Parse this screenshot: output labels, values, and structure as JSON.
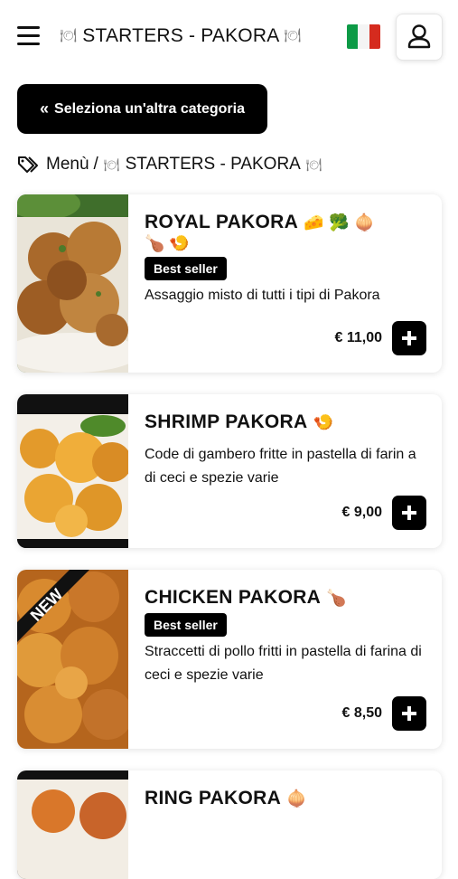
{
  "header": {
    "title": "STARTERS - PAKORA",
    "plate_glyph": "🍽",
    "flag_colors": [
      "#0d9a46",
      "#ffffff",
      "#d52b1e"
    ]
  },
  "category_button": {
    "chevron": "«",
    "label": "Seleziona un'altra categoria"
  },
  "breadcrumb": {
    "menu": "Menù",
    "separator": "/",
    "current": "STARTERS - PAKORA"
  },
  "products": [
    {
      "name": "ROYAL PAKORA",
      "emojis": "🧀 🥦 🧅",
      "emojis2": "🍗 🍤",
      "badge": "Best seller",
      "description": "Assaggio misto di tutti i tipi di Pakora",
      "price": "€ 11,00"
    },
    {
      "name": "SHRIMP PAKORA",
      "emojis": "🍤",
      "description": "Code di gambero fritte in pastella di farin a di ceci e spezie varie",
      "price": "€ 9,00"
    },
    {
      "name": "CHICKEN PAKORA",
      "emojis": "🍗",
      "badge": "Best seller",
      "ribbon": "NEW",
      "description": "Straccetti di pollo fritti in pastella di farina di ceci e spezie varie",
      "price": "€ 8,50"
    },
    {
      "name": "RING PAKORA",
      "emojis": "🧅"
    }
  ],
  "colors": {
    "accent": "#000000",
    "background": "#ffffff"
  }
}
